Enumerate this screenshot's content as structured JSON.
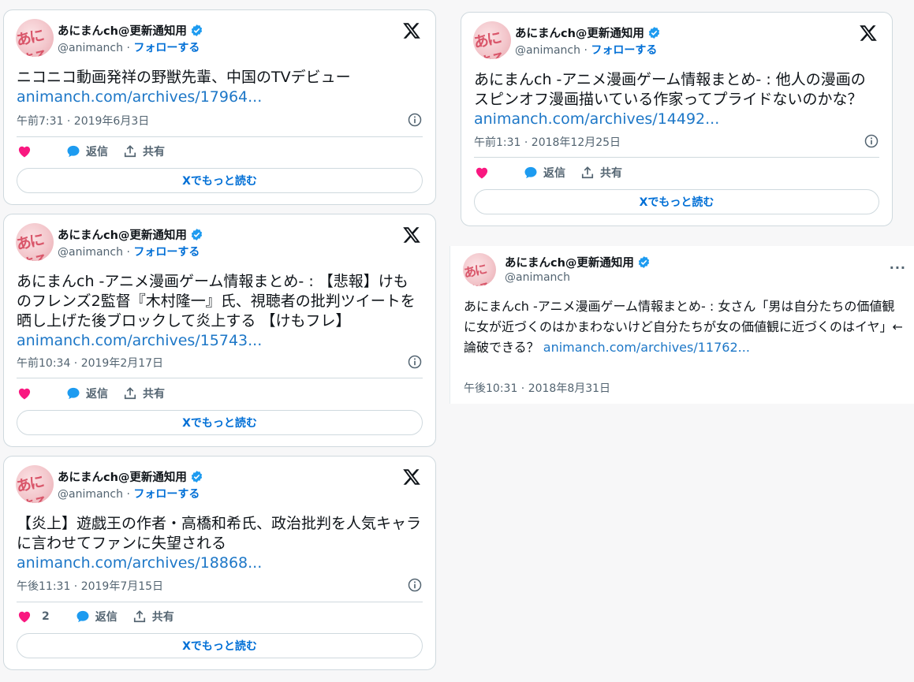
{
  "tweets": [
    {
      "name": "あにまんch@更新通知用",
      "handle": "@animanch",
      "sep": " · ",
      "follow": "フォローする",
      "text": "ニコニコ動画発祥の野獣先輩、中国のTVデビュー",
      "link": "animanch.com/archives/17964...",
      "datetime": "午前7:31 · 2019年6月3日",
      "reply": "返信",
      "share": "共有",
      "like_count": "",
      "readmore": "Xでもっと読む"
    },
    {
      "name": "あにまんch@更新通知用",
      "handle": "@animanch",
      "sep": " · ",
      "follow": "フォローする",
      "text": "あにまんch -アニメ漫画ゲーム情報まとめ- : 【悲報】けものフレンズ2監督『木村隆一』氏、視聴者の批判ツイートを晒し上げた後ブロックして炎上する 【けもフレ】",
      "link": "animanch.com/archives/15743...",
      "datetime": "午前10:34 · 2019年2月17日",
      "reply": "返信",
      "share": "共有",
      "like_count": "",
      "readmore": "Xでもっと読む"
    },
    {
      "name": "あにまんch@更新通知用",
      "handle": "@animanch",
      "sep": " · ",
      "follow": "フォローする",
      "text": "【炎上】遊戯王の作者・高橋和希氏、政治批判を人気キャラに言わせてファンに失望される",
      "link": "animanch.com/archives/18868...",
      "datetime": "午後11:31 · 2019年7月15日",
      "reply": "返信",
      "share": "共有",
      "like_count": "2",
      "readmore": "Xでもっと読む"
    },
    {
      "name": "あにまんch@更新通知用",
      "handle": "@animanch",
      "sep": " · ",
      "follow": "フォローする",
      "text": "あにまんch -アニメ漫画ゲーム情報まとめ- : 他人の漫画のスピンオフ漫画描いている作家ってプライドないのかな？",
      "link": "animanch.com/archives/14492...",
      "datetime": "午前1:31 · 2018年12月25日",
      "reply": "返信",
      "share": "共有",
      "like_count": "",
      "readmore": "Xでもっと読む"
    },
    {
      "name": "あにまんch@更新通知用",
      "handle": "@animanch",
      "text": "あにまんch -アニメ漫画ゲーム情報まとめ- : 女さん「男は自分たちの価値観に女が近づくのはかまわないけど自分たちが女の価値観に近づくのはイヤ」←論破できる？",
      "link": "animanch.com/archives/11762...",
      "datetime": "午後10:31 · 2018年8月31日",
      "more": "···"
    }
  ],
  "avatar_logo": "あにまる",
  "colors": {
    "accent": "#006fd6",
    "link": "#1d77c7",
    "heart": "#f91880",
    "verified": "#1d9bf0"
  }
}
